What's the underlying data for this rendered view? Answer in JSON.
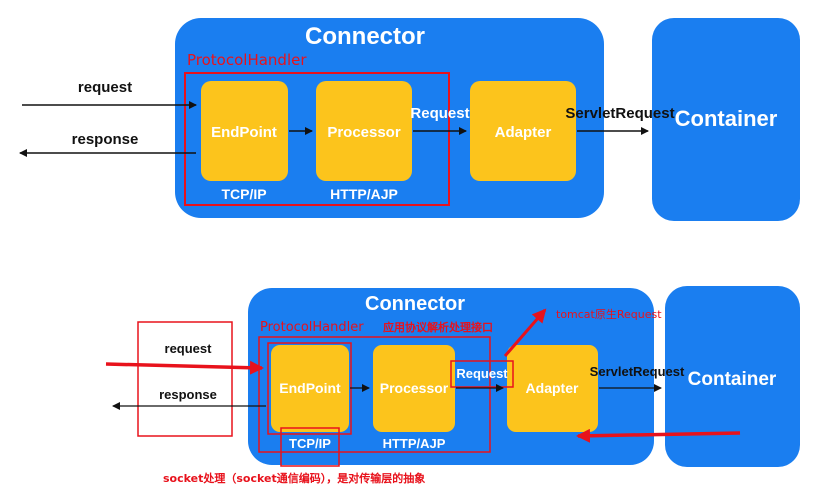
{
  "top": {
    "connector_label": "Connector",
    "protocol_handler_label": "ProtocolHandler",
    "endpoint_label": "EndPoint",
    "processor_label": "Processor",
    "adapter_label": "Adapter",
    "container_label": "Container",
    "tcp_label": "TCP/IP",
    "http_label": "HTTP/AJP",
    "request_label": "request",
    "response_label": "response",
    "request_arrow_label": "Request",
    "servlet_request_label": "ServletRequest"
  },
  "bottom": {
    "connector_label": "Connector",
    "protocol_handler_label": "ProtocolHandler",
    "protocol_note": "应用协议解析处理接口",
    "tomcat_note": "tomcat原生Request",
    "endpoint_label": "EndPoint",
    "processor_label": "Processor",
    "adapter_label": "Adapter",
    "container_label": "Container",
    "tcp_label": "TCP/IP",
    "http_label": "HTTP/AJP",
    "request_label": "request",
    "response_label": "response",
    "request_arrow_label": "Request",
    "servlet_request_label": "ServletRequest",
    "socket_note": "socket处理（socket通信编码），是对传输层的抽象"
  },
  "colors": {
    "blue": "#1a7ef0",
    "yellow": "#fcc41c",
    "red": "#e8121c",
    "black": "#111111"
  }
}
